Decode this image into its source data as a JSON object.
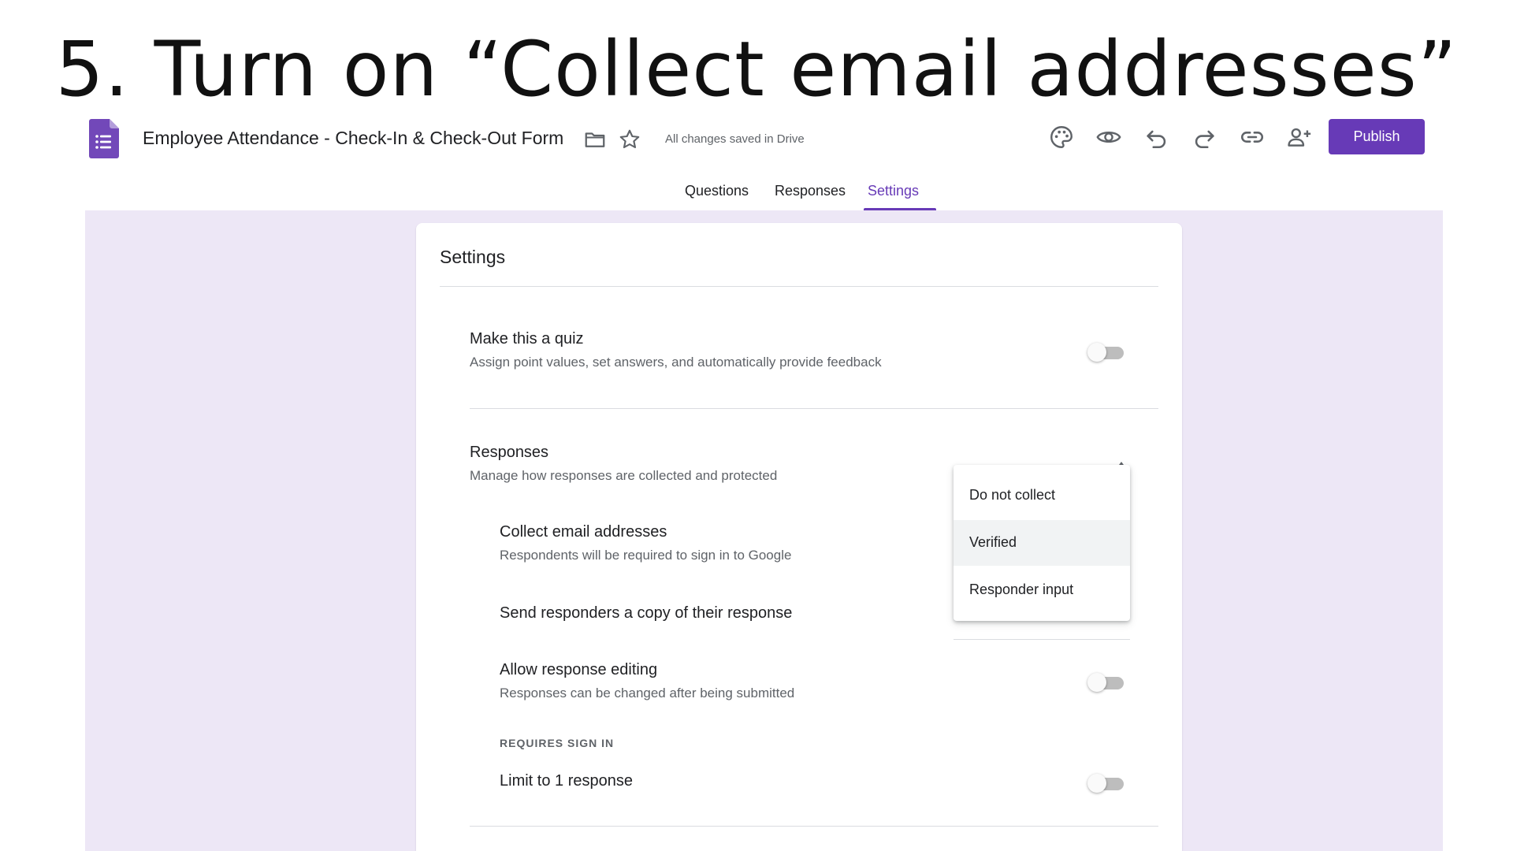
{
  "slide_title": "5. Turn on “Collect email addresses”",
  "header": {
    "doc_title": "Employee Attendance -  Check-In & Check-Out Form",
    "save_status": "All changes saved in Drive",
    "publish_label": "Publish",
    "accent_color": "#673ab7"
  },
  "tabs": [
    {
      "label": "Questions"
    },
    {
      "label": "Responses"
    },
    {
      "label": "Settings",
      "active": true
    }
  ],
  "settings": {
    "title": "Settings",
    "quiz": {
      "title": "Make this a quiz",
      "subtitle": "Assign point values, set answers, and automatically provide feedback",
      "enabled": false
    },
    "responses": {
      "title": "Responses",
      "subtitle": "Manage how responses are collected and protected",
      "collect_email": {
        "title": "Collect email addresses",
        "subtitle": "Respondents will be required to sign in to Google"
      },
      "send_copy": {
        "title": "Send responders a copy of their response"
      },
      "allow_editing": {
        "title": "Allow response editing",
        "subtitle": "Responses can be changed after being submitted",
        "enabled": false
      },
      "requires_sign_in_label": "REQUIRES SIGN IN",
      "limit_one": {
        "title": "Limit to 1 response",
        "enabled": false
      }
    }
  },
  "email_dropdown": {
    "options": [
      "Do not collect",
      "Verified",
      "Responder input"
    ],
    "highlighted": "Verified"
  }
}
